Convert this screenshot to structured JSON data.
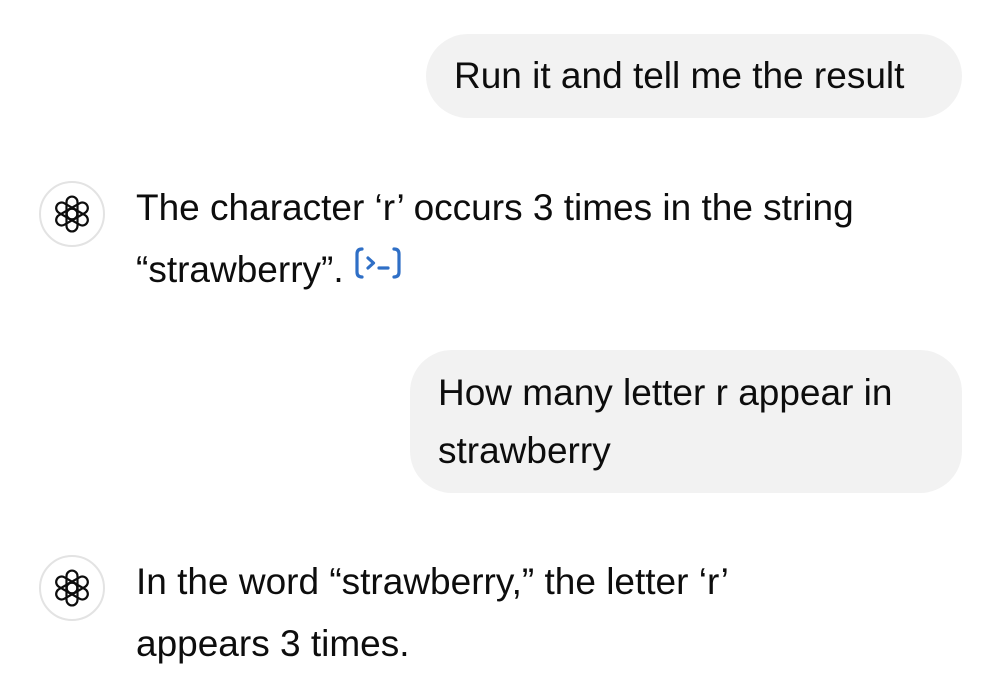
{
  "conversation": {
    "messages": [
      {
        "role": "user",
        "text": "Run it and tell me the result"
      },
      {
        "role": "assistant",
        "text": "The character ‘r’ occurs 3 times in the string “strawberry”.",
        "icon": "openai-logo-icon",
        "action_icon": "code-interpreter-icon"
      },
      {
        "role": "user",
        "text": "How many letter r appear in strawberry"
      },
      {
        "role": "assistant",
        "text": "In the word “strawberry,” the letter ‘r’ appears 3 times.",
        "icon": "openai-logo-icon"
      }
    ]
  },
  "colors": {
    "user_bubble": "#f2f2f2",
    "text": "#0d0d0d",
    "avatar_border": "#e3e3e3",
    "code_link": "#2f6fc6"
  }
}
